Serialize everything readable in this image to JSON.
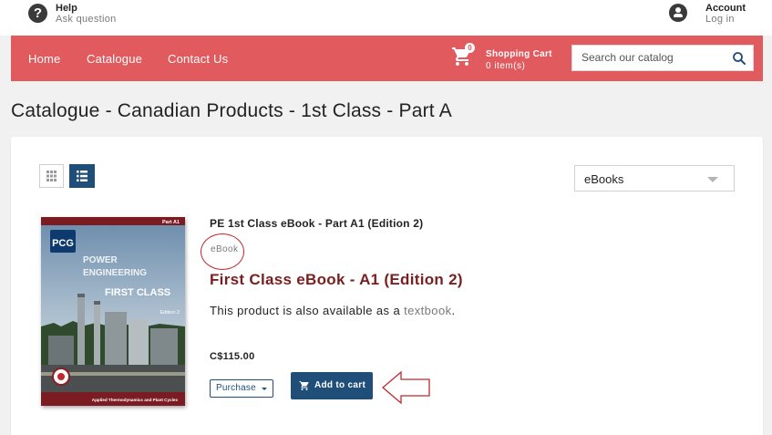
{
  "header": {
    "help_title": "Help",
    "help_subtitle": "Ask question",
    "account_title": "Account",
    "account_subtitle": "Log in"
  },
  "nav": {
    "links": [
      "Home",
      "Catalogue",
      "Contact Us"
    ],
    "cart_badge": "0",
    "cart_title": "Shopping Cart",
    "cart_count": "0 item(s)",
    "search_placeholder": "Search our catalog"
  },
  "page": {
    "title": "Catalogue - Canadian Products - 1st Class - Part A"
  },
  "toolbar": {
    "sort_value": "eBooks"
  },
  "product": {
    "name": "PE 1st Class eBook - Part A1 (Edition 2)",
    "type": "eBook",
    "title": "First Class eBook - A1 (Edition 2)",
    "avail_prefix": "This product is also available as a ",
    "avail_link": "textbook",
    "avail_suffix": ".",
    "price": "C$115.00",
    "purchase_option": "Purchase",
    "add_to_cart": "Add to cart",
    "cover": {
      "corner": "Part A1",
      "logo": "PCG",
      "line1": "POWER",
      "line2": "ENGINEERING",
      "line3": "FIRST CLASS",
      "edition": "Edition 2",
      "footer": "Applied Thermodynamics and Plant Cycles"
    }
  },
  "colors": {
    "navbar": "#e05a5e",
    "primary": "#1f4e79",
    "product_title": "#7a1f1f",
    "annotation": "#c0282d"
  }
}
